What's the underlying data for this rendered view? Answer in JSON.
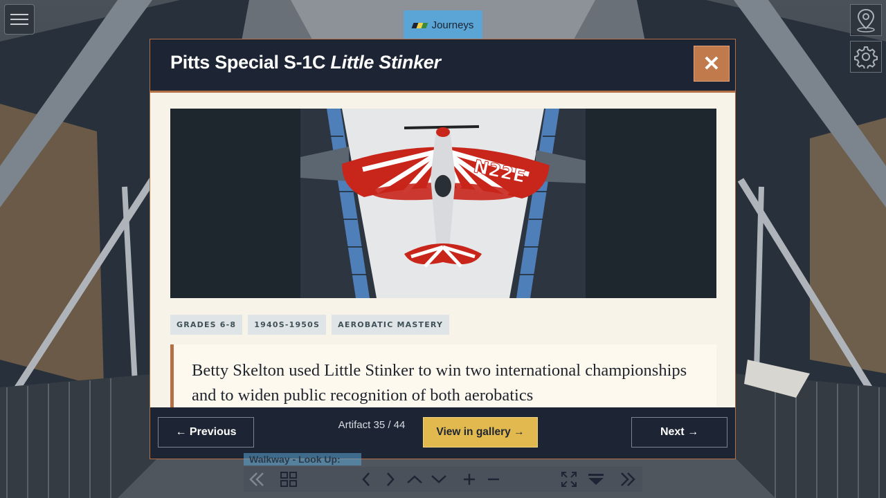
{
  "journeys": {
    "label": "Journeys"
  },
  "modal": {
    "title_plain": "Pitts Special S-1C ",
    "title_italic": "Little Stinker",
    "close_glyph": "✕",
    "hero_alt": "Pitts Special S-1C Little Stinker hanging from museum ceiling",
    "aircraft_registration": "N22E",
    "tags": [
      "GRADES 6-8",
      "1940S-1950S",
      "AEROBATIC MASTERY"
    ],
    "quote": "Betty Skelton used Little Stinker to win two international championships and to widen public recognition of both aerobatics"
  },
  "footer": {
    "previous_label": "← Previous",
    "counter": "Artifact 35 / 44",
    "gallery_label": "View in gallery →",
    "next_label": "Next →"
  },
  "panorama": {
    "caption": "Walkway - Look Up:"
  },
  "colors": {
    "header_bg": "#1d2433",
    "accent_copper": "#b56f45",
    "gallery_yellow": "#e2b94e",
    "journeys_blue": "#5aa5d6",
    "paper": "#f7f3e8"
  },
  "icons": {
    "menu": "hamburger-icon",
    "location": "map-pin-icon",
    "settings": "gear-icon",
    "toolbar": [
      "skip-back-icon",
      "grid-icon",
      "arrow-left-icon",
      "arrow-right-icon",
      "arrow-up-icon",
      "arrow-down-icon",
      "zoom-in-icon",
      "zoom-out-icon",
      "fullscreen-icon",
      "hide-toolbar-icon",
      "skip-forward-icon"
    ]
  }
}
